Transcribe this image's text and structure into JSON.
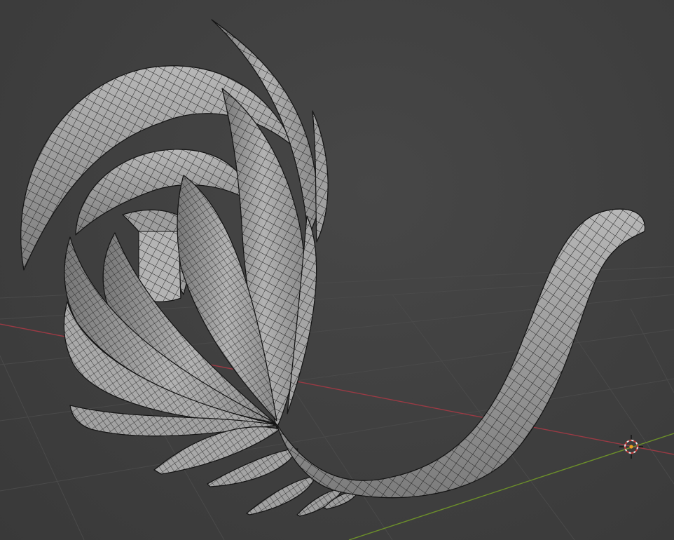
{
  "viewport": {
    "background": "#3d3d3d",
    "grid_color": "#4a4a4a",
    "x_axis_color": "#9b3a44",
    "y_axis_color": "#6c8f2a",
    "mesh_fill": "#a7a7a7",
    "mesh_shade": "#6d6d6d",
    "wire_color": "#141414",
    "cursor_icon": "3d-cursor-icon",
    "origin_icon": "object-origin-icon"
  }
}
